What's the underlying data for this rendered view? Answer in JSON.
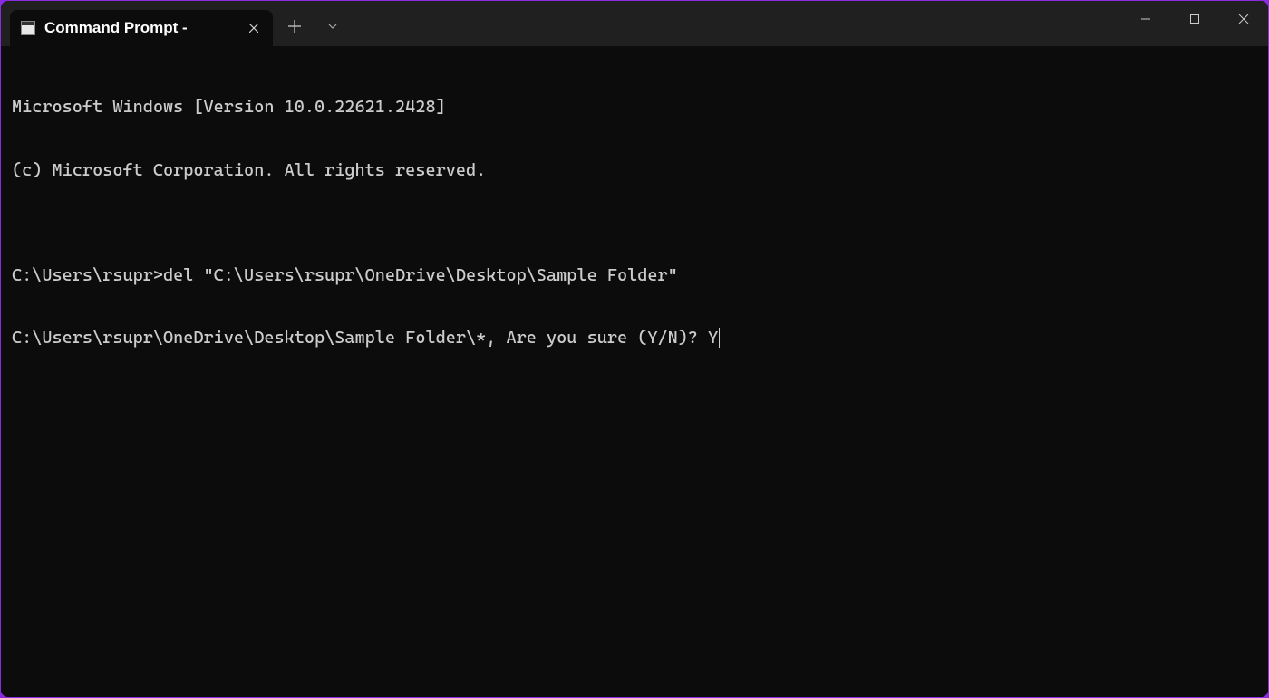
{
  "titlebar": {
    "tab_title": "Command Prompt - ",
    "tab_icon": "cmd-icon"
  },
  "terminal": {
    "lines": [
      "Microsoft Windows [Version 10.0.22621.2428]",
      "(c) Microsoft Corporation. All rights reserved.",
      "",
      "C:\\Users\\rsupr>del \"C:\\Users\\rsupr\\OneDrive\\Desktop\\Sample Folder\"",
      "C:\\Users\\rsupr\\OneDrive\\Desktop\\Sample Folder\\*, Are you sure (Y/N)? Y"
    ]
  }
}
